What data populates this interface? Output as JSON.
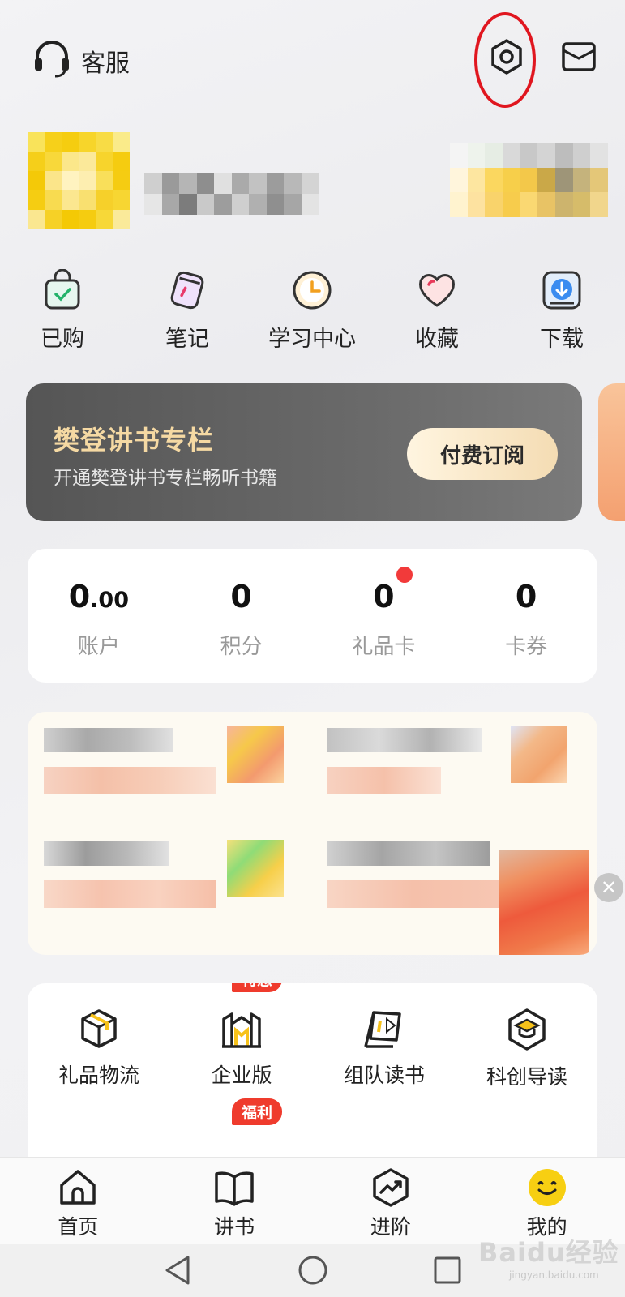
{
  "header": {
    "customer_service_label": "客服",
    "settings_icon": "gear-hexagon-icon",
    "mail_icon": "mail-icon"
  },
  "quick_menu": [
    {
      "label": "已购",
      "icon": "purchased-bag-icon"
    },
    {
      "label": "笔记",
      "icon": "notes-icon"
    },
    {
      "label": "学习中心",
      "icon": "learning-clock-icon"
    },
    {
      "label": "收藏",
      "icon": "heart-icon"
    },
    {
      "label": "下载",
      "icon": "download-icon"
    }
  ],
  "banner": {
    "title": "樊登讲书专栏",
    "subtitle": "开通樊登讲书专栏畅听书籍",
    "button": "付费订阅"
  },
  "stats": [
    {
      "value_main": "0",
      "value_small": ".00",
      "label": "账户"
    },
    {
      "value_main": "0",
      "value_small": "",
      "label": "积分"
    },
    {
      "value_main": "0",
      "value_small": "",
      "label": "礼品卡",
      "has_dot": true
    },
    {
      "value_main": "0",
      "value_small": "",
      "label": "卡券"
    }
  ],
  "services": [
    {
      "label": "礼品物流",
      "icon": "package-box-icon"
    },
    {
      "label": "企业版",
      "icon": "enterprise-icon",
      "tag": "特惠"
    },
    {
      "label": "组队读书",
      "icon": "flag-icon"
    },
    {
      "label": "科创导读",
      "icon": "scholar-badge-icon"
    }
  ],
  "services_row2_tag": "福利",
  "tabbar": [
    {
      "label": "首页",
      "icon": "home-icon"
    },
    {
      "label": "讲书",
      "icon": "book-icon"
    },
    {
      "label": "进阶",
      "icon": "trend-icon"
    },
    {
      "label": "我的",
      "icon": "smile-face-icon"
    }
  ],
  "watermark": {
    "main": "Baidu经验",
    "sub": "jingyan.baidu.com"
  }
}
